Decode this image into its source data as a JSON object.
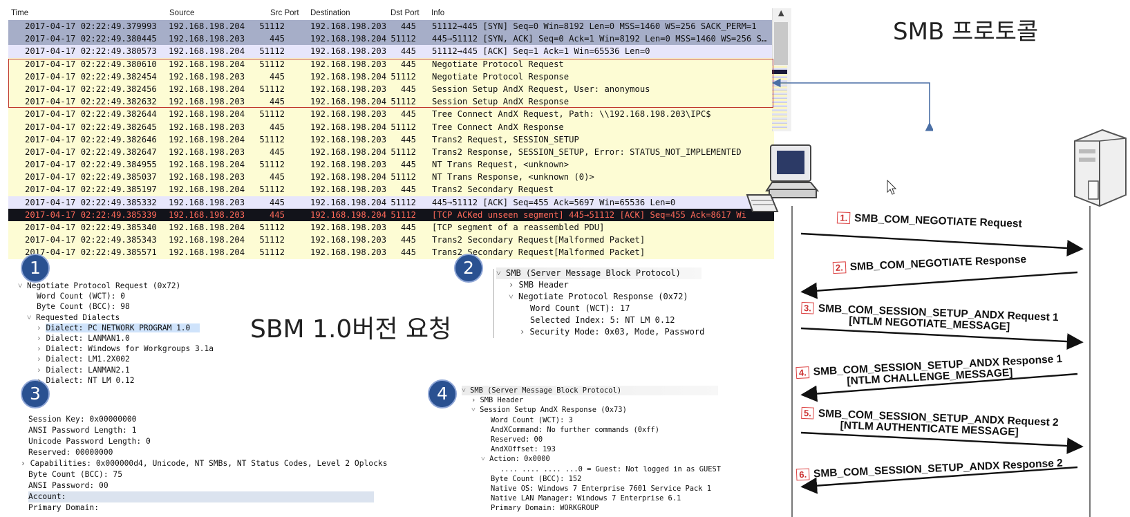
{
  "packet_list": {
    "columns": {
      "time": "Time",
      "source": "Source",
      "src_port": "Src Port",
      "destination": "Destination",
      "dst_port": "Dst Port",
      "info": "Info"
    },
    "rows": [
      {
        "time": "2017-04-17 02:22:49.379993",
        "src": "192.168.198.204",
        "sport": "51112",
        "dst": "192.168.198.203",
        "dport": "445",
        "info": "51112→445 [SYN] Seq=0 Win=8192 Len=0 MSS=1460 WS=256 SACK_PERM=1",
        "style": "gray"
      },
      {
        "time": "2017-04-17 02:22:49.380445",
        "src": "192.168.198.203",
        "sport": "445",
        "dst": "192.168.198.204",
        "dport": "51112",
        "info": "445→51112 [SYN, ACK] Seq=0 Ack=1 Win=8192 Len=0 MSS=1460 WS=256 S…",
        "style": "gray"
      },
      {
        "time": "2017-04-17 02:22:49.380573",
        "src": "192.168.198.204",
        "sport": "51112",
        "dst": "192.168.198.203",
        "dport": "445",
        "info": "51112→445 [ACK] Seq=1 Ack=1 Win=65536 Len=0",
        "style": "lav"
      },
      {
        "time": "2017-04-17 02:22:49.380610",
        "src": "192.168.198.204",
        "sport": "51112",
        "dst": "192.168.198.203",
        "dport": "445",
        "info": "Negotiate Protocol Request",
        "style": "yel"
      },
      {
        "time": "2017-04-17 02:22:49.382454",
        "src": "192.168.198.203",
        "sport": "445",
        "dst": "192.168.198.204",
        "dport": "51112",
        "info": "Negotiate Protocol Response",
        "style": "yel"
      },
      {
        "time": "2017-04-17 02:22:49.382456",
        "src": "192.168.198.204",
        "sport": "51112",
        "dst": "192.168.198.203",
        "dport": "445",
        "info": "Session Setup AndX Request, User: anonymous",
        "style": "yel"
      },
      {
        "time": "2017-04-17 02:22:49.382632",
        "src": "192.168.198.203",
        "sport": "445",
        "dst": "192.168.198.204",
        "dport": "51112",
        "info": "Session Setup AndX Response",
        "style": "yel"
      },
      {
        "time": "2017-04-17 02:22:49.382644",
        "src": "192.168.198.204",
        "sport": "51112",
        "dst": "192.168.198.203",
        "dport": "445",
        "info": "Tree Connect AndX Request, Path: \\\\192.168.198.203\\IPC$",
        "style": "yel"
      },
      {
        "time": "2017-04-17 02:22:49.382645",
        "src": "192.168.198.203",
        "sport": "445",
        "dst": "192.168.198.204",
        "dport": "51112",
        "info": "Tree Connect AndX Response",
        "style": "yel"
      },
      {
        "time": "2017-04-17 02:22:49.382646",
        "src": "192.168.198.204",
        "sport": "51112",
        "dst": "192.168.198.203",
        "dport": "445",
        "info": "Trans2 Request, SESSION_SETUP",
        "style": "yel"
      },
      {
        "time": "2017-04-17 02:22:49.382647",
        "src": "192.168.198.203",
        "sport": "445",
        "dst": "192.168.198.204",
        "dport": "51112",
        "info": "Trans2 Response, SESSION_SETUP, Error: STATUS_NOT_IMPLEMENTED",
        "style": "yel"
      },
      {
        "time": "2017-04-17 02:22:49.384955",
        "src": "192.168.198.204",
        "sport": "51112",
        "dst": "192.168.198.203",
        "dport": "445",
        "info": "NT Trans Request, <unknown>",
        "style": "yel"
      },
      {
        "time": "2017-04-17 02:22:49.385037",
        "src": "192.168.198.203",
        "sport": "445",
        "dst": "192.168.198.204",
        "dport": "51112",
        "info": "NT Trans Response, <unknown (0)>",
        "style": "yel"
      },
      {
        "time": "2017-04-17 02:22:49.385197",
        "src": "192.168.198.204",
        "sport": "51112",
        "dst": "192.168.198.203",
        "dport": "445",
        "info": "Trans2 Secondary Request",
        "style": "yel"
      },
      {
        "time": "2017-04-17 02:22:49.385332",
        "src": "192.168.198.203",
        "sport": "445",
        "dst": "192.168.198.204",
        "dport": "51112",
        "info": "445→51112 [ACK] Seq=455 Ack=5697 Win=65536 Len=0",
        "style": "lav"
      },
      {
        "time": "2017-04-17 02:22:49.385339",
        "src": "192.168.198.203",
        "sport": "445",
        "dst": "192.168.198.204",
        "dport": "51112",
        "info": "[TCP ACKed unseen segment] 445→51112 [ACK] Seq=455 Ack=8617 Wi",
        "style": "black"
      },
      {
        "time": "2017-04-17 02:22:49.385340",
        "src": "192.168.198.204",
        "sport": "51112",
        "dst": "192.168.198.203",
        "dport": "445",
        "info": "[TCP segment of a reassembled PDU]",
        "style": "yel"
      },
      {
        "time": "2017-04-17 02:22:49.385343",
        "src": "192.168.198.204",
        "sport": "51112",
        "dst": "192.168.198.203",
        "dport": "445",
        "info": "Trans2 Secondary Request[Malformed Packet]",
        "style": "yel"
      },
      {
        "time": "2017-04-17 02:22:49.385571",
        "src": "192.168.198.204",
        "sport": "51112",
        "dst": "192.168.198.203",
        "dport": "445",
        "info": "Trans2 Secondary Request[Malformed Packet]",
        "style": "yel"
      }
    ]
  },
  "titles": {
    "smb_protocol": "SMB 프로토콜",
    "smb1_request": "SBM 1.0버전 요청"
  },
  "callouts": {
    "n1": "1",
    "n2": "2",
    "n3": "3",
    "n4": "4"
  },
  "detail1": {
    "root": "Negotiate Protocol Request (0x72)",
    "wct": "Word Count (WCT): 0",
    "bcc": "Byte Count (BCC): 98",
    "dialects_label": "Requested Dialects",
    "dialects": [
      "Dialect: PC NETWORK PROGRAM 1.0",
      "Dialect: LANMAN1.0",
      "Dialect: Windows for Workgroups 3.1a",
      "Dialect: LM1.2X002",
      "Dialect: LANMAN2.1",
      "Dialect: NT LM 0.12"
    ]
  },
  "detail2": {
    "root": "SMB (Server Message Block Protocol)",
    "header": "SMB Header",
    "resp": "Negotiate Protocol Response (0x72)",
    "wct": "Word Count (WCT): 17",
    "index": "Selected Index: 5: NT LM 0.12",
    "security": "Security Mode: 0x03, Mode, Password"
  },
  "detail3": {
    "lines": [
      "Session Key: 0x00000000",
      "ANSI Password Length: 1",
      "Unicode Password Length: 0",
      "Reserved: 00000000"
    ],
    "capabilities": "Capabilities: 0x000000d4, Unicode, NT SMBs, NT Status Codes, Level 2 Oplocks",
    "bcc": "Byte Count (BCC): 75",
    "ansi": "ANSI Password: 00",
    "account": "Account:",
    "domain": "Primary Domain:"
  },
  "detail4": {
    "root": "SMB (Server Message Block Protocol)",
    "header": "SMB Header",
    "resp": "Session Setup AndX Response (0x73)",
    "wct": "Word Count (WCT): 3",
    "andx": "AndXCommand: No further commands (0xff)",
    "reserved": "Reserved: 00",
    "offset": "AndXOffset: 193",
    "action": "Action: 0x0000",
    "guest": ".... .... .... ...0 = Guest: Not logged in as GUEST",
    "bcc": "Byte Count (BCC): 152",
    "os": "Native OS: Windows 7 Enterprise 7601 Service Pack 1",
    "lanman": "Native LAN Manager: Windows 7 Enterprise 6.1",
    "domain": "Primary Domain: WORKGROUP"
  },
  "diagram": {
    "messages": [
      {
        "num": "1.",
        "line1": "SMB_COM_NEGOTIATE Request",
        "line2": ""
      },
      {
        "num": "2.",
        "line1": "SMB_COM_NEGOTIATE Response",
        "line2": ""
      },
      {
        "num": "3.",
        "line1": "SMB_COM_SESSION_SETUP_ANDX Request 1",
        "line2": "[NTLM NEGOTIATE_MESSAGE]"
      },
      {
        "num": "4.",
        "line1": "SMB_COM_SESSION_SETUP_ANDX Response 1",
        "line2": "[NTLM CHALLENGE_MESSAGE]"
      },
      {
        "num": "5.",
        "line1": "SMB_COM_SESSION_SETUP_ANDX Request 2",
        "line2": "[NTLM AUTHENTICATE MESSAGE]"
      },
      {
        "num": "6.",
        "line1": "SMB_COM_SESSION_SETUP_ANDX Response 2",
        "line2": ""
      }
    ]
  },
  "colors": {
    "callout_blue": "#2a5191",
    "highlight_red": "#c0392b",
    "connector_blue": "#4a6fa5"
  }
}
